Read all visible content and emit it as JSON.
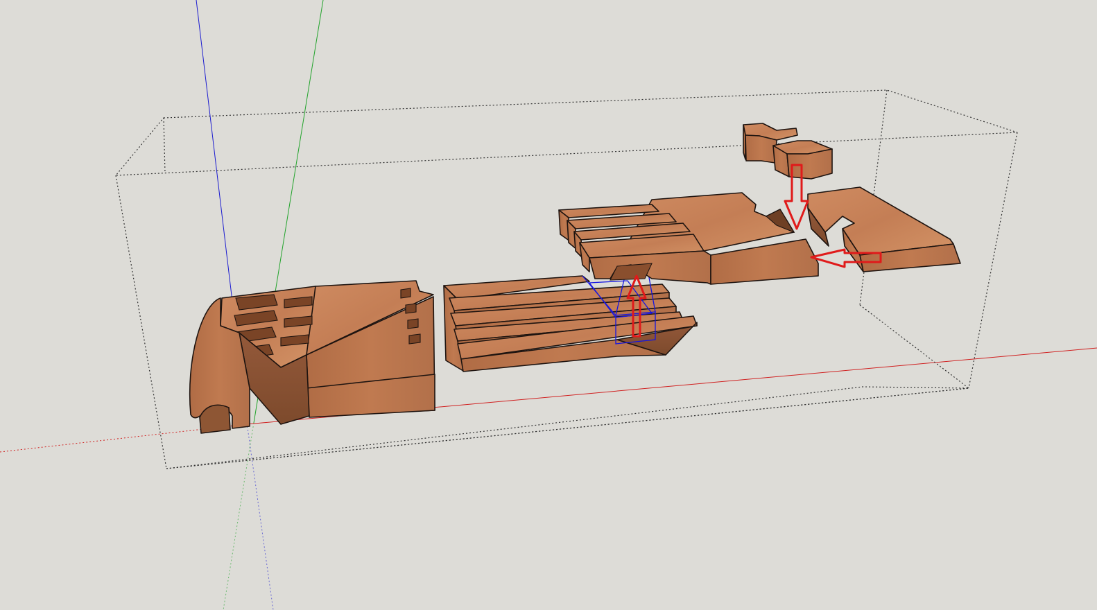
{
  "viewport": {
    "background": "#dddcd7",
    "axes": {
      "red": "#d02020",
      "green": "#21a32b",
      "blue": "#1a1ad0"
    },
    "wood": {
      "top": "#c8825a",
      "front": "#b5714b",
      "side": "#8e5634",
      "dark": "#6e3f24"
    },
    "annotation_arrow_color": "#e01a1a",
    "selection_color": "#1515e0"
  },
  "scene": {
    "objects": [
      {
        "name": "hinge-piece",
        "icon": "wood-joint-part"
      },
      {
        "name": "fingered-tongue-piece",
        "icon": "wood-joint-part"
      },
      {
        "name": "notched-slotted-piece",
        "icon": "wood-joint-part"
      },
      {
        "name": "dovetail-keys",
        "icon": "wood-joint-part"
      }
    ],
    "arrows": [
      {
        "name": "arrow-up",
        "icon": "arrow-up-icon"
      },
      {
        "name": "arrow-down",
        "icon": "arrow-down-icon"
      },
      {
        "name": "arrow-left",
        "icon": "arrow-left-icon"
      }
    ]
  }
}
